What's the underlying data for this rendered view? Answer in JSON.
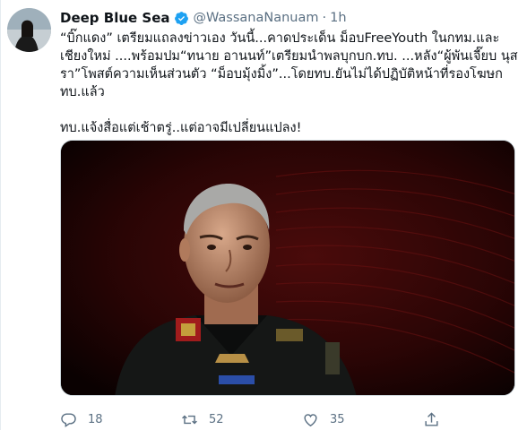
{
  "author": {
    "display_name": "Deep Blue Sea",
    "handle": "@WassanaNanuam",
    "separator": "·",
    "time": "1h",
    "verified_icon": "verified-badge-icon"
  },
  "tweet": {
    "lines": [
      "“บิ๊กแดง” เตรียมแถลงข่าวเอง วันนี้...คาดประเด็น ม็อบFreeYouth ในกทม.และ",
      "เชียงใหม่ ....พร้อมปม“ทนาย อานนท์”เตรียมนำพลบุกบก.ทบ. ...หลัง“ผู้พันเจี๊ยบ นุส",
      "รา”โพสต์ความเห็นส่วนตัว “ม็อบมุ้งมิ้ง”...โดยทบ.ยันไม่ได้ปฏิบัติหน้าที่รองโฆษก",
      "ทบ.แล้ว"
    ],
    "last_line": "ทบ.แจ้งสื่อแต่เช้าตรู่..แต่อาจมีเปลี่ยนแปลง!"
  },
  "actions": {
    "reply_count": "18",
    "retweet_count": "52",
    "like_count": "35"
  },
  "colors": {
    "text": "#0f1419",
    "secondary": "#5b7083",
    "verified": "#1da1f2"
  }
}
